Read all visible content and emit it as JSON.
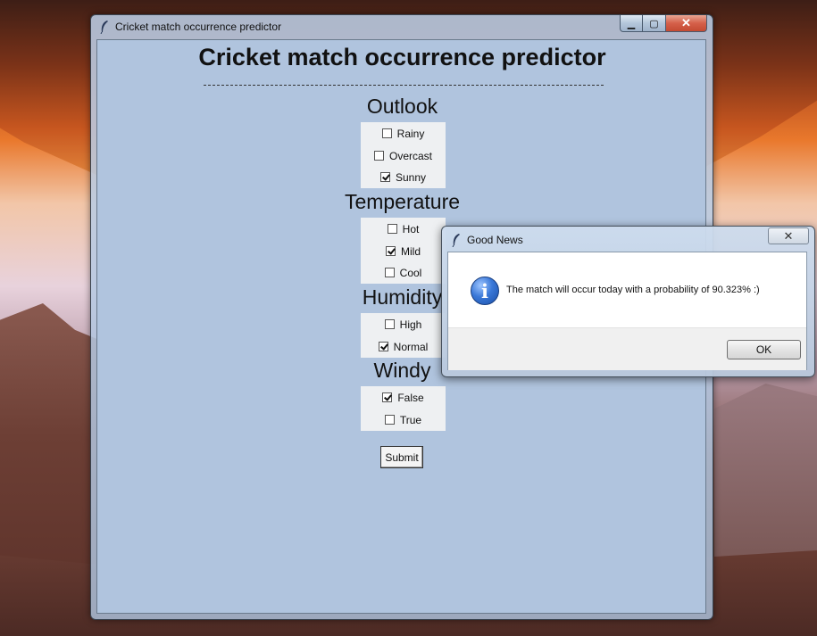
{
  "main_window": {
    "title": "Cricket match occurrence predictor",
    "controls": {
      "minimize": "▁",
      "maximize": "▢",
      "close": "✕"
    }
  },
  "app": {
    "heading": "Cricket match occurrence predictor",
    "sections": {
      "outlook": {
        "heading": "Outlook",
        "options": [
          {
            "label": "Rainy",
            "checked": false
          },
          {
            "label": "Overcast",
            "checked": false
          },
          {
            "label": "Sunny",
            "checked": true
          }
        ]
      },
      "temperature": {
        "heading": "Temperature",
        "options": [
          {
            "label": "Hot",
            "checked": false
          },
          {
            "label": "Mild",
            "checked": true
          },
          {
            "label": "Cool",
            "checked": false
          }
        ]
      },
      "humidity": {
        "heading": "Humidity",
        "options": [
          {
            "label": "High",
            "checked": false
          },
          {
            "label": "Normal",
            "checked": true
          }
        ]
      },
      "windy": {
        "heading": "Windy",
        "options": [
          {
            "label": "False",
            "checked": true
          },
          {
            "label": "True",
            "checked": false
          }
        ]
      }
    },
    "submit_label": "Submit"
  },
  "dialog": {
    "title": "Good News",
    "close": "✕",
    "icon": "info-icon",
    "icon_glyph": "i",
    "message": "The match will occur today with a probability of 90.323% :)",
    "ok_label": "OK"
  },
  "colors": {
    "client_bg": "#b0c4de",
    "option_bg": "#eef0f2",
    "info_icon": "#3a78d8"
  }
}
